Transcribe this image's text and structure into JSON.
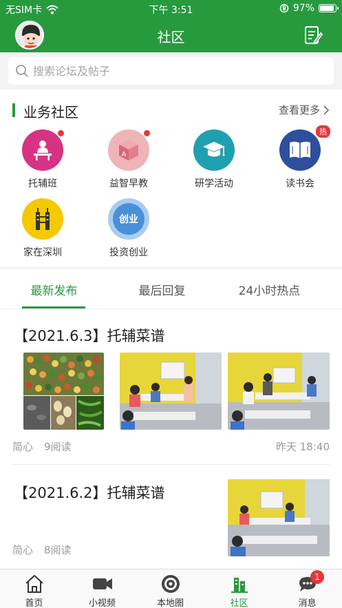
{
  "status_bar": {
    "carrier": "无SIM卡",
    "time": "下午 3:51",
    "battery": "97%",
    "battery_level": 0.97
  },
  "header": {
    "title": "社区"
  },
  "search": {
    "placeholder": "搜索论坛及帖子"
  },
  "section": {
    "title": "业务社区",
    "more": "查看更多"
  },
  "communities": [
    {
      "label": "托辅班",
      "icon": "teacher-desk-icon",
      "color": "#d63384",
      "dot": true
    },
    {
      "label": "益智早教",
      "icon": "toy-block-icon",
      "color": "#e8a0a8",
      "dot": true
    },
    {
      "label": "研学活动",
      "icon": "graduation-cap-icon",
      "color": "#1fa0b0",
      "dot": false
    },
    {
      "label": "读书会",
      "icon": "open-book-icon",
      "color": "#2e4f9c",
      "badge": "热"
    },
    {
      "label": "家在深圳",
      "icon": "city-tower-icon",
      "color": "#f2c200"
    },
    {
      "label": "投资创业",
      "icon": "startup-icon",
      "color": "#4a90d9",
      "icon_text": "创业"
    }
  ],
  "tabs": [
    "最新发布",
    "最后回复",
    "24小时热点"
  ],
  "posts": [
    {
      "title": "【2021.6.3】托辅菜谱",
      "author": "简心",
      "reads": "9阅读",
      "time": "昨天 18:40"
    },
    {
      "title": "【2021.6.2】托辅菜谱",
      "author": "简心",
      "reads": "8阅读"
    }
  ],
  "tab_bar": {
    "items": [
      {
        "label": "首页",
        "icon": "home-icon"
      },
      {
        "label": "小视频",
        "icon": "video-camera-icon"
      },
      {
        "label": "本地圈",
        "icon": "target-icon"
      },
      {
        "label": "社区",
        "icon": "community-buildings-icon"
      },
      {
        "label": "消息",
        "icon": "chat-bubble-icon"
      }
    ],
    "message_badge": "1"
  },
  "colors": {
    "brand": "#279a3e",
    "badge": "#e8363a"
  }
}
